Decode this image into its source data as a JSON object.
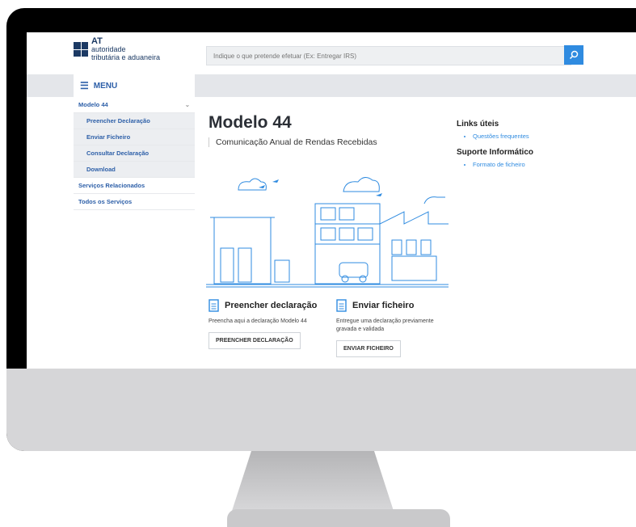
{
  "logo": {
    "abbr": "AT",
    "line1": "autoridade",
    "line2": "tributária e aduaneira"
  },
  "search": {
    "placeholder": "Indique o que pretende efetuar (Ex: Entregar IRS)",
    "icon": "search-icon"
  },
  "menu": {
    "label": "MENU",
    "icon": "hamburger-icon"
  },
  "sidebar": {
    "items": [
      {
        "label": "Modelo 44",
        "type": "top"
      },
      {
        "label": "Preencher Declaração",
        "type": "sub"
      },
      {
        "label": "Enviar Ficheiro",
        "type": "sub"
      },
      {
        "label": "Consultar Declaração",
        "type": "sub"
      },
      {
        "label": "Download",
        "type": "sub"
      },
      {
        "label": "Serviços Relacionados",
        "type": "plain"
      },
      {
        "label": "Todos os Serviços",
        "type": "plain"
      }
    ]
  },
  "main": {
    "title": "Modelo 44",
    "subtitle": "Comunicação Anual de Rendas Recebidas",
    "actions": [
      {
        "title": "Preencher declaração",
        "desc": "Preencha aqui a declaração Modelo 44",
        "button": "PREENCHER DECLARAÇÃO"
      },
      {
        "title": "Enviar ficheiro",
        "desc": "Entregue uma declaração previamente gravada e validada",
        "button": "ENVIAR FICHEIRO"
      }
    ]
  },
  "links": {
    "useful_title": "Links úteis",
    "useful": [
      "Questões frequentes"
    ],
    "support_title": "Suporte Informático",
    "support": [
      "Formato de ficheiro"
    ]
  },
  "colors": {
    "brand": "#1c3a64",
    "accent": "#2f8be0",
    "link": "#2d5fa8"
  }
}
